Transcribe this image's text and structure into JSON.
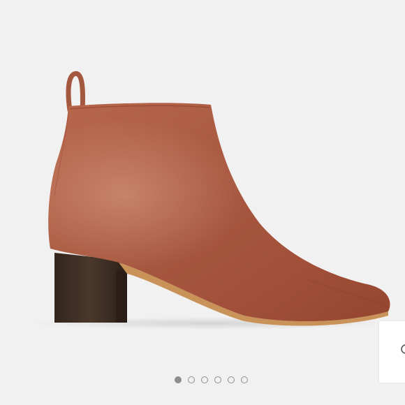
{
  "carousel": {
    "image": {
      "subject": "ankle-boot",
      "leather_color": "#a85a42",
      "heel_color": "#3f2f24",
      "sole_edge_color": "#c99258"
    },
    "total_slides": 6,
    "active_slide": 1
  },
  "zoom_button": {
    "icon": "magnifier-icon"
  },
  "colors": {
    "background": "#f2f1f1",
    "dot": "#8e8e8e",
    "zoom_panel": "#ffffff"
  }
}
